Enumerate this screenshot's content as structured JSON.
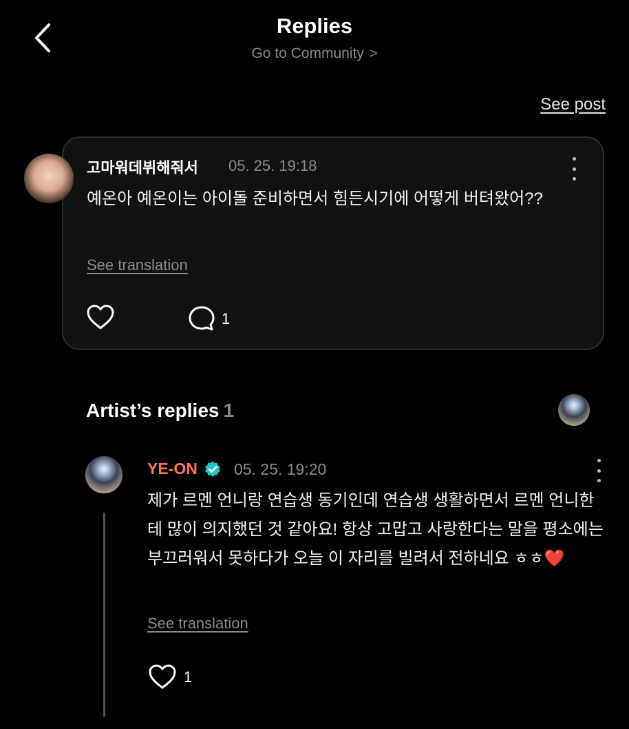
{
  "header": {
    "title": "Replies",
    "subtitle": "Go to Community",
    "subtitle_chevron": ">",
    "back_icon": "chevron-left-icon"
  },
  "see_post_label": "See post",
  "comment": {
    "username": "고마워데뷔해줘서",
    "timestamp": "05. 25. 19:18",
    "text": "예온아 예온이는 아이돌 준비하면서 힘든시기에 어떻게 버텨왔어??",
    "see_translation": "See translation",
    "reply_count": "1",
    "icons": [
      "heart-outline-icon",
      "comment-bubble-icon",
      "more-vertical-icon"
    ]
  },
  "artist_replies": {
    "title": "Artist’s replies",
    "count": "1"
  },
  "reply": {
    "username": "YE-ON",
    "username_color": "#ff7657",
    "verified_color": "#28c4c9",
    "timestamp": "05. 25. 19:20",
    "text": "제가 르멘 언니랑 연습생 동기인데 연습생 생활하면서 르멘 언니한테 많이 의지했던 것 같아요! 항상 고맙고 사랑한다는 말을 평소에는 부끄러워서 못하다가 오늘 이 자리를 빌려서 전하네요 ㅎㅎ",
    "emoji": "❤️",
    "see_translation": "See translation",
    "like_count": "1"
  }
}
